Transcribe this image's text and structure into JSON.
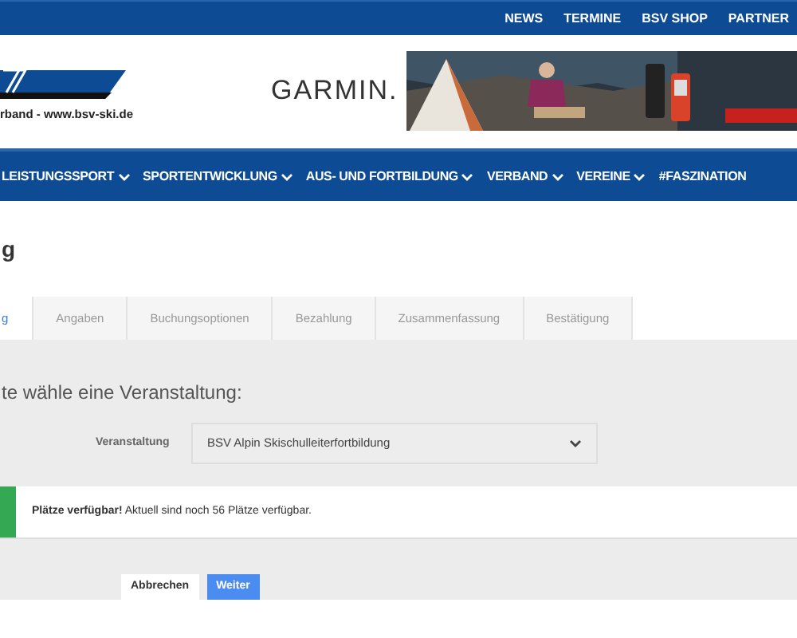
{
  "top_links": [
    "NEWS",
    "TERMINE",
    "BSV SHOP",
    "PARTNER"
  ],
  "logo": {
    "tagline": "rband - www.bsv-ski.de"
  },
  "banner": {
    "brand": "GARMIN.",
    "kind": "picture"
  },
  "nav": [
    "LEISTUNGSSPORT",
    "SPORTENTWICKLUNG",
    "AUS- UND FORTBILDUNG",
    "VERBAND",
    "VEREINE",
    "#FASZINATION"
  ],
  "page_title": "g",
  "steps": [
    {
      "label": "g",
      "selected": true
    },
    {
      "label": "Angaben",
      "selected": false
    },
    {
      "label": "Buchungsoptionen",
      "selected": false
    },
    {
      "label": "Bezahlung",
      "selected": false
    },
    {
      "label": "Zusammenfassung",
      "selected": false
    },
    {
      "label": "Bestätigung",
      "selected": false
    }
  ],
  "prompt": "te wähle eine Veranstaltung:",
  "select": {
    "label": "Veranstaltung",
    "value": "BSV Alpin Skischulleiterfortbildung"
  },
  "alert": {
    "text": "**Plätze verfügbar!** Aktuell sind noch 56 Plätze verfügbar.",
    "color": "#34a853"
  },
  "buttons": [
    {
      "label": "Abbrechen",
      "kind": "secondary"
    },
    {
      "label": "Weiter",
      "kind": "primary"
    }
  ]
}
